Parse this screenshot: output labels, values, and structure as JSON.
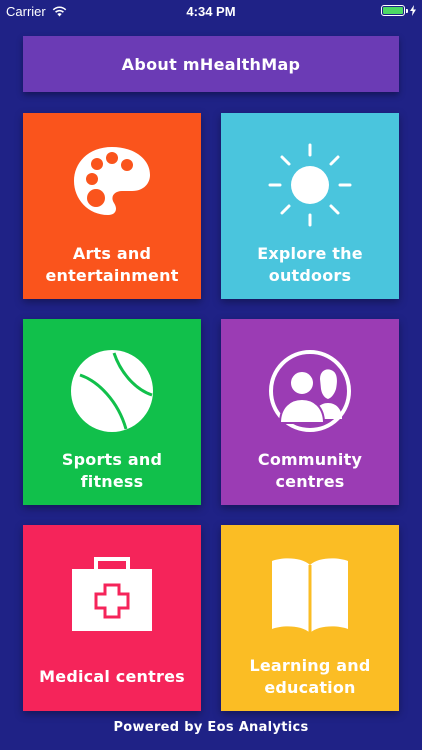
{
  "status_bar": {
    "carrier": "Carrier",
    "time": "4:34 PM",
    "battery_level": 1.0
  },
  "header": {
    "about_label": "About mHealthMap"
  },
  "tiles": [
    {
      "label": "Arts and entertainment",
      "icon": "palette-icon",
      "color": "#fa541c"
    },
    {
      "label": "Explore the outdoors",
      "icon": "sun-icon",
      "color": "#4ac5dd"
    },
    {
      "label": "Sports and fitness",
      "icon": "tennis-ball-icon",
      "color": "#11c04b"
    },
    {
      "label": "Community centres",
      "icon": "people-icon",
      "color": "#9b3cb4"
    },
    {
      "label": "Medical centres",
      "icon": "medical-kit-icon",
      "color": "#f5245a"
    },
    {
      "label": "Learning and education",
      "icon": "book-icon",
      "color": "#fbbd24"
    }
  ],
  "footer": {
    "text": "Powered by Eos Analytics"
  },
  "colors": {
    "background": "#1f2286",
    "about_button": "#6b3bb5",
    "battery_fill": "#4cd964"
  }
}
